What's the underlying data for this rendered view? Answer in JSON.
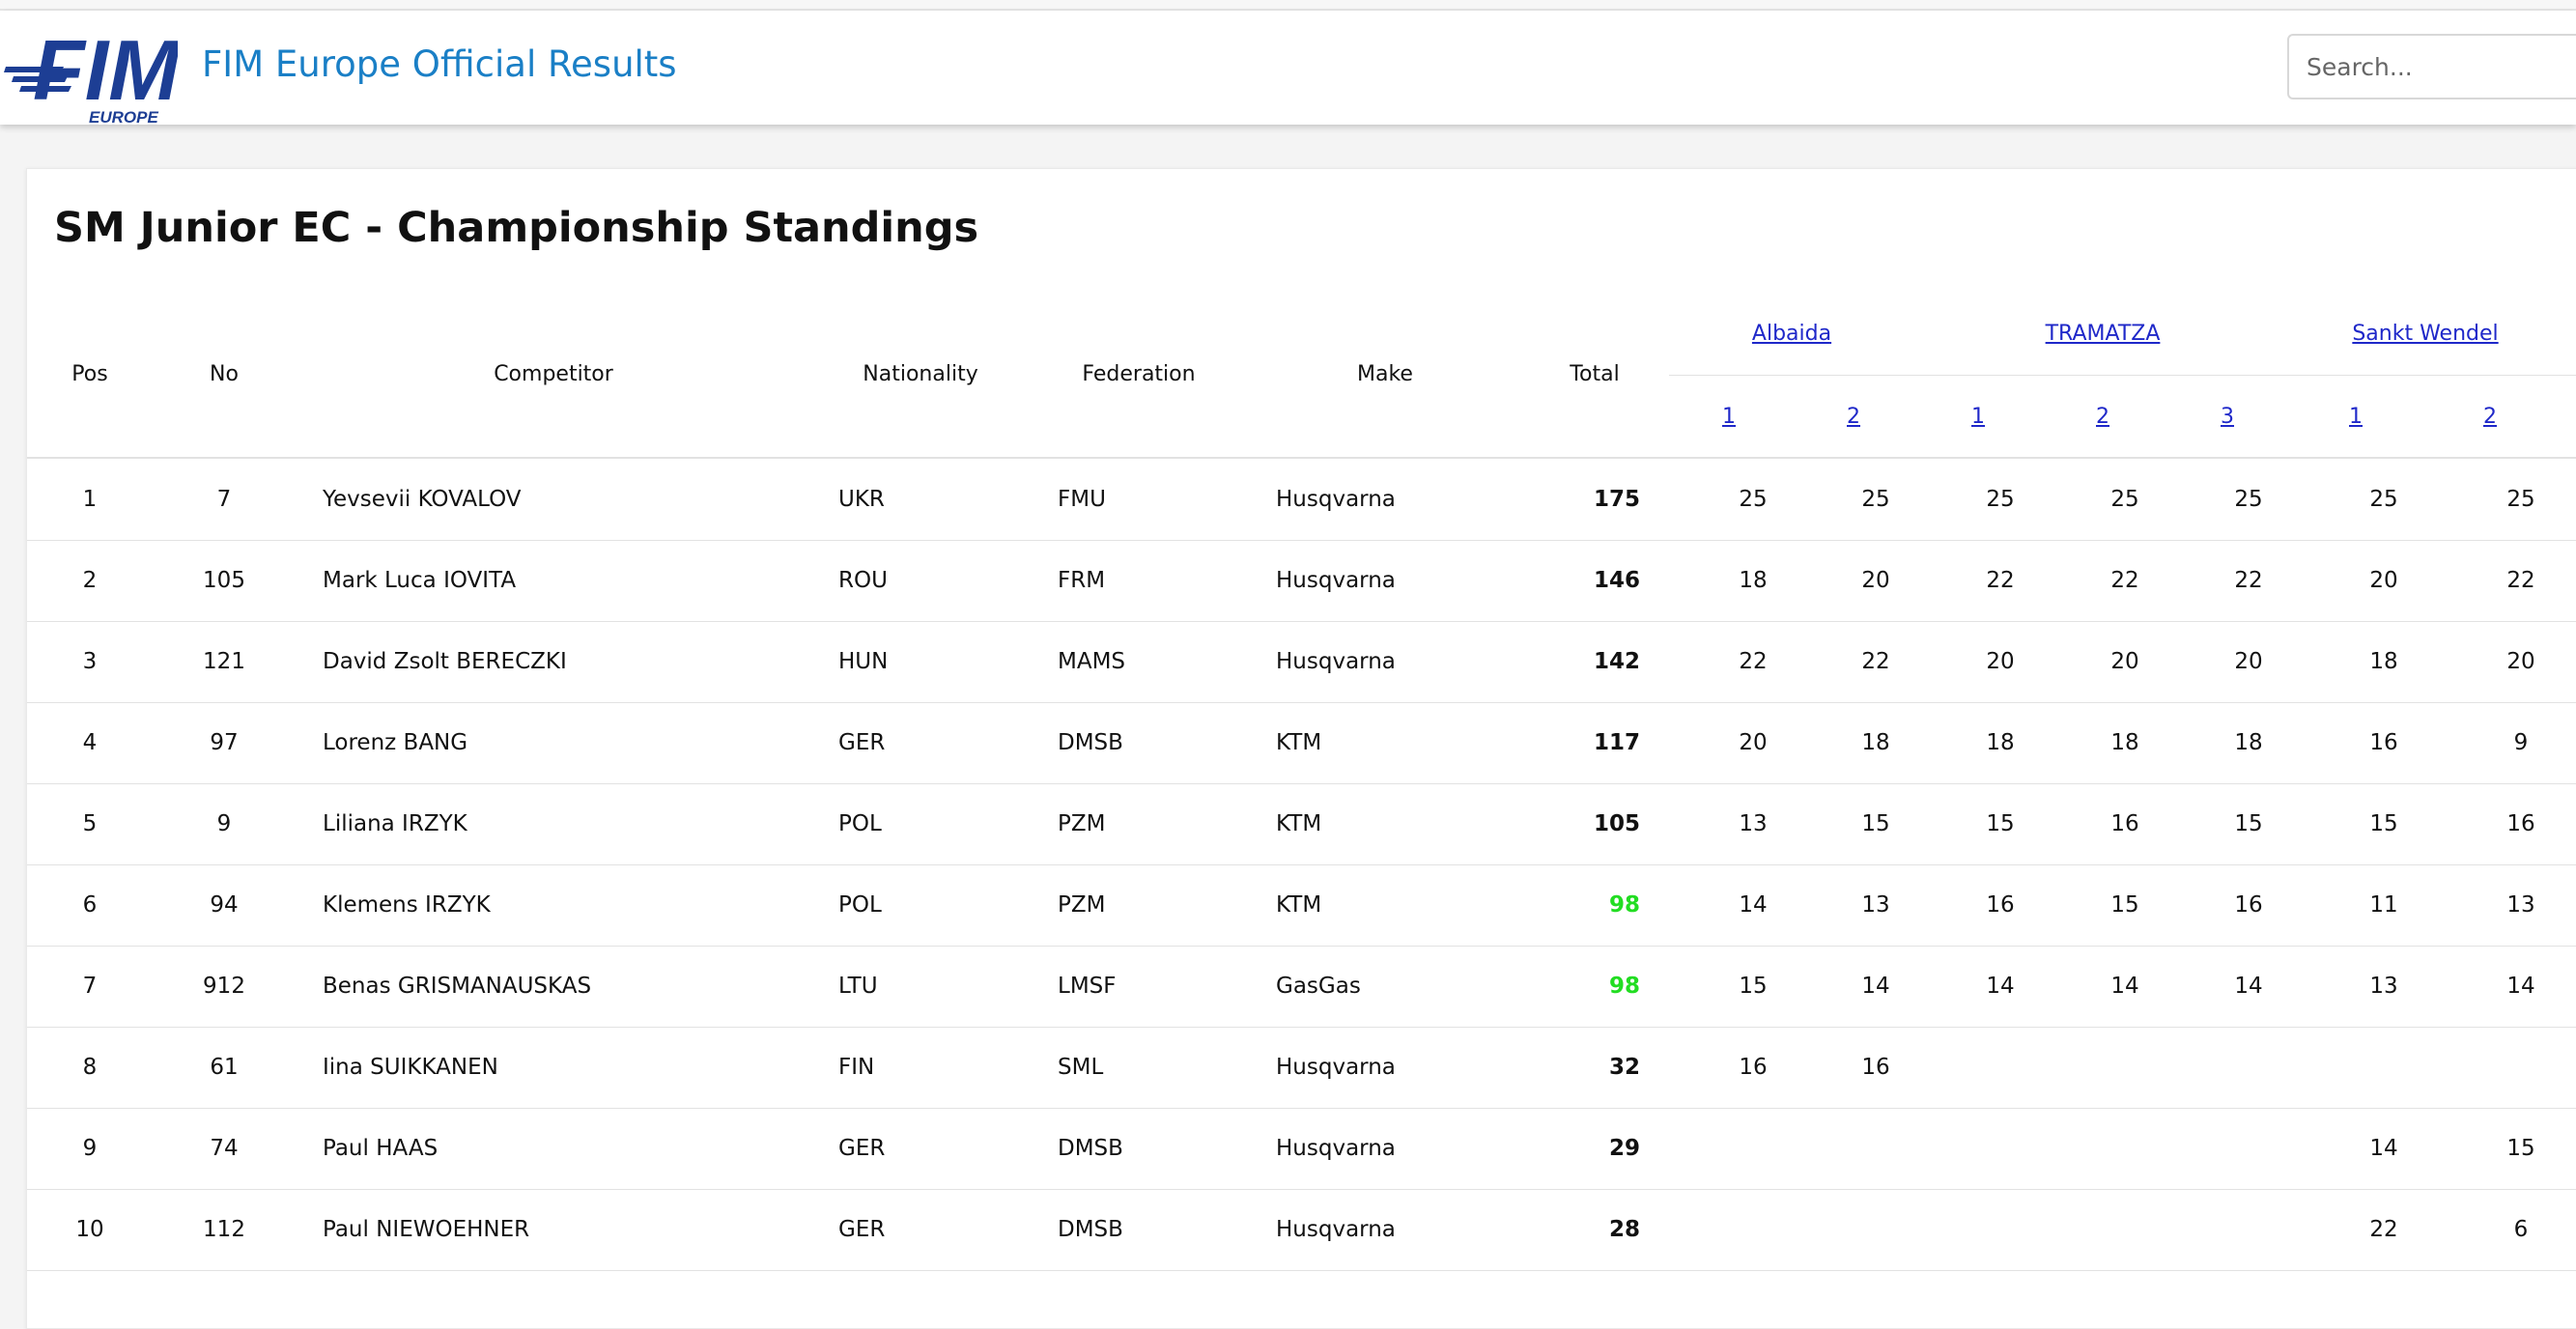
{
  "site": {
    "title": "FIM Europe Official Results",
    "logo_text": "FIM",
    "logo_subtext": "EUROPE",
    "search_placeholder": "Search..."
  },
  "page": {
    "title": "SM Junior EC - Championship Standings"
  },
  "table": {
    "headers": {
      "pos": "Pos",
      "no": "No",
      "competitor": "Competitor",
      "nationality": "Nationality",
      "federation": "Federation",
      "make": "Make",
      "total": "Total"
    },
    "events": [
      {
        "name": "Albaida",
        "races": [
          "1",
          "2"
        ]
      },
      {
        "name": "TRAMATZA",
        "races": [
          "1",
          "2",
          "3"
        ]
      },
      {
        "name": "Sankt Wendel",
        "races": [
          "1",
          "2"
        ]
      }
    ],
    "rows": [
      {
        "pos": "1",
        "no": "7",
        "competitor": "Yevsevii KOVALOV",
        "nationality": "UKR",
        "federation": "FMU",
        "make": "Husqvarna",
        "total": "175",
        "highlight": false,
        "points": [
          "25",
          "25",
          "25",
          "25",
          "25",
          "25",
          "25"
        ]
      },
      {
        "pos": "2",
        "no": "105",
        "competitor": "Mark Luca IOVITA",
        "nationality": "ROU",
        "federation": "FRM",
        "make": "Husqvarna",
        "total": "146",
        "highlight": false,
        "points": [
          "18",
          "20",
          "22",
          "22",
          "22",
          "20",
          "22"
        ]
      },
      {
        "pos": "3",
        "no": "121",
        "competitor": "David Zsolt BERECZKI",
        "nationality": "HUN",
        "federation": "MAMS",
        "make": "Husqvarna",
        "total": "142",
        "highlight": false,
        "points": [
          "22",
          "22",
          "20",
          "20",
          "20",
          "18",
          "20"
        ]
      },
      {
        "pos": "4",
        "no": "97",
        "competitor": "Lorenz BANG",
        "nationality": "GER",
        "federation": "DMSB",
        "make": "KTM",
        "total": "117",
        "highlight": false,
        "points": [
          "20",
          "18",
          "18",
          "18",
          "18",
          "16",
          "9"
        ]
      },
      {
        "pos": "5",
        "no": "9",
        "competitor": "Liliana IRZYK",
        "nationality": "POL",
        "federation": "PZM",
        "make": "KTM",
        "total": "105",
        "highlight": false,
        "points": [
          "13",
          "15",
          "15",
          "16",
          "15",
          "15",
          "16"
        ]
      },
      {
        "pos": "6",
        "no": "94",
        "competitor": "Klemens IRZYK",
        "nationality": "POL",
        "federation": "PZM",
        "make": "KTM",
        "total": "98",
        "highlight": true,
        "points": [
          "14",
          "13",
          "16",
          "15",
          "16",
          "11",
          "13"
        ]
      },
      {
        "pos": "7",
        "no": "912",
        "competitor": "Benas GRISMANAUSKAS",
        "nationality": "LTU",
        "federation": "LMSF",
        "make": "GasGas",
        "total": "98",
        "highlight": true,
        "points": [
          "15",
          "14",
          "14",
          "14",
          "14",
          "13",
          "14"
        ]
      },
      {
        "pos": "8",
        "no": "61",
        "competitor": "Iina SUIKKANEN",
        "nationality": "FIN",
        "federation": "SML",
        "make": "Husqvarna",
        "total": "32",
        "highlight": false,
        "points": [
          "16",
          "16",
          "",
          "",
          "",
          "",
          ""
        ]
      },
      {
        "pos": "9",
        "no": "74",
        "competitor": "Paul HAAS",
        "nationality": "GER",
        "federation": "DMSB",
        "make": "Husqvarna",
        "total": "29",
        "highlight": false,
        "points": [
          "",
          "",
          "",
          "",
          "",
          "14",
          "15"
        ]
      },
      {
        "pos": "10",
        "no": "112",
        "competitor": "Paul NIEWOEHNER",
        "nationality": "GER",
        "federation": "DMSB",
        "make": "Husqvarna",
        "total": "28",
        "highlight": false,
        "points": [
          "",
          "",
          "",
          "",
          "",
          "22",
          "6"
        ]
      }
    ]
  },
  "colors": {
    "brand_blue": "#1a7fc6",
    "logo_blue": "#1d3e94",
    "link_blue": "#1f28c9",
    "tie_green": "#22dd22",
    "text": "#111111"
  }
}
